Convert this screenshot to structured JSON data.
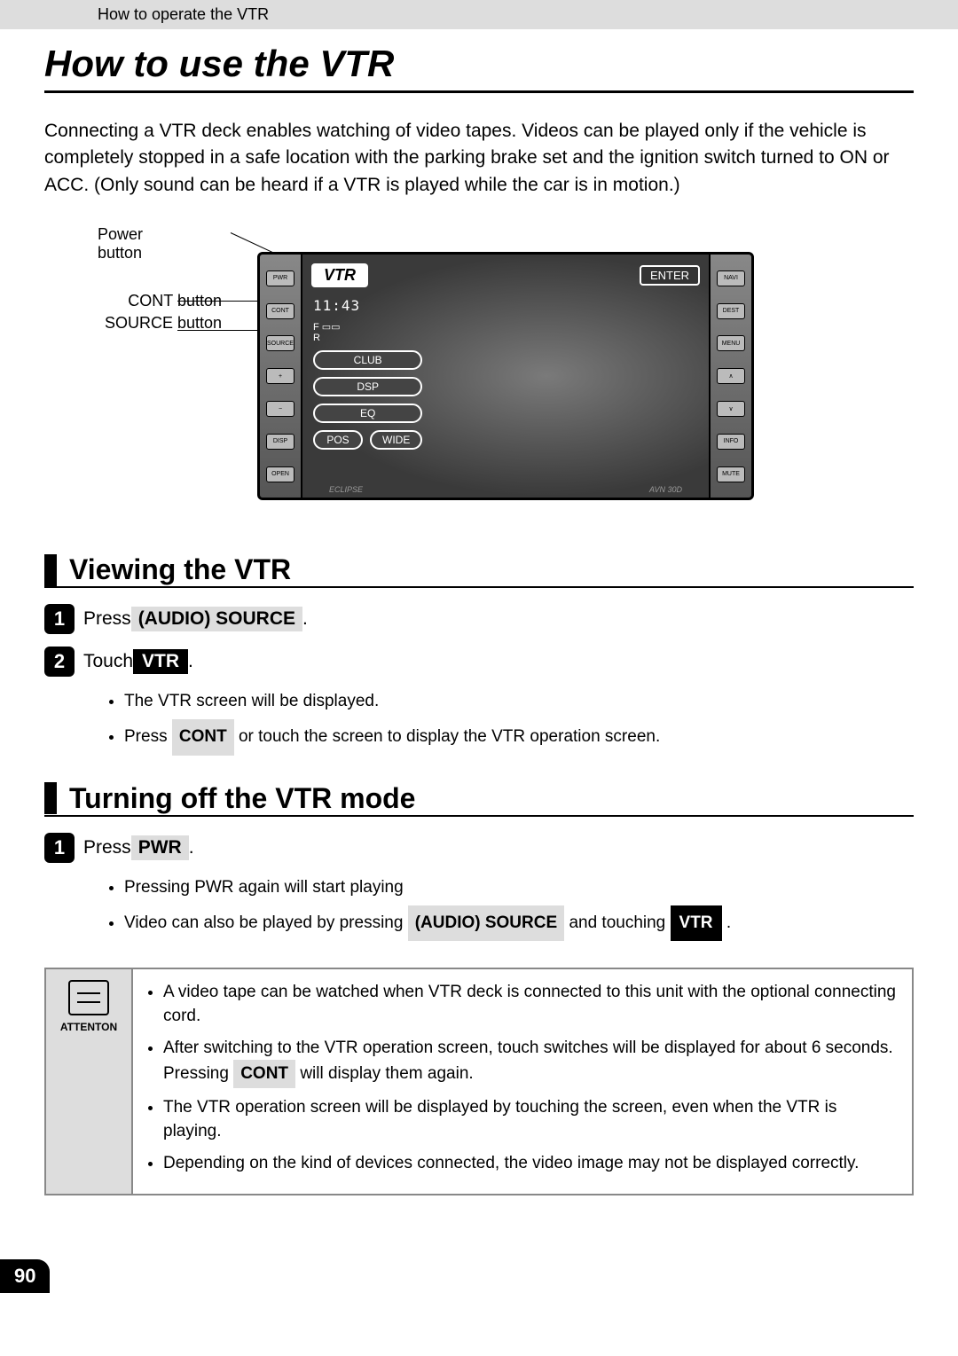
{
  "header": {
    "breadcrumb": "How to operate the VTR"
  },
  "title": "How to use the VTR",
  "intro": "Connecting a VTR deck enables watching of video tapes.  Videos can be played only if the vehicle is completely stopped in a safe location with the parking brake set and the ignition switch turned to ON or ACC.  (Only sound can be heard if a VTR is played while the car is in motion.)",
  "diagram": {
    "callouts": {
      "power": "Power button",
      "cont": "CONT button",
      "source": "SOURCE button"
    },
    "screen": {
      "title_tag": "VTR",
      "enter": "ENTER",
      "time": "11:43",
      "buttons": {
        "club": "CLUB",
        "dsp": "DSP",
        "eq": "EQ",
        "pos": "POS",
        "wide": "WIDE"
      },
      "brand_left": "ECLIPSE",
      "brand_right": "AVN 30D"
    },
    "side_labels": {
      "pwr": "PWR",
      "cont": "CONT",
      "source": "SOURCE",
      "navi": "NAVI",
      "dest": "DEST",
      "menu": "MENU",
      "info": "INFO",
      "mute": "MUTE",
      "disp": "DISP",
      "open": "OPEN"
    }
  },
  "sections": {
    "viewing": {
      "title": "Viewing the VTR",
      "steps": [
        {
          "num": "1",
          "prefix": "Press ",
          "button": "(AUDIO) SOURCE",
          "suffix": " ."
        },
        {
          "num": "2",
          "prefix": "Touch ",
          "button_solid": "VTR",
          "suffix": " ."
        }
      ],
      "bullets": [
        "The VTR screen will be displayed."
      ],
      "bullet2_prefix": "Press  ",
      "bullet2_button": "CONT",
      "bullet2_suffix": "  or touch the screen to display the VTR operation screen."
    },
    "turning_off": {
      "title": "Turning off the VTR mode",
      "step": {
        "num": "1",
        "prefix": "Press ",
        "button": "PWR",
        "suffix": " ."
      },
      "bullets": [
        "Pressing PWR again will start playing"
      ],
      "bullet2_prefix": "Video can also be played by pressing ",
      "bullet2_btn1": "(AUDIO) SOURCE",
      "bullet2_mid": "  and touching  ",
      "bullet2_btn2": "VTR",
      "bullet2_suffix": " ."
    }
  },
  "attention": {
    "label": "ATTENTON",
    "items": {
      "i1": "A video tape can be watched when VTR deck is connected to this unit with the optional connecting cord.",
      "i2a": "After switching to the VTR operation screen, touch switches will be displayed for about 6 seconds.  Pressing  ",
      "i2btn": "CONT",
      "i2b": "  will display them again.",
      "i3": "The VTR operation screen will be displayed by touching the screen, even when the VTR is playing.",
      "i4": "Depending on the kind of devices connected, the video image may not be displayed correctly."
    }
  },
  "page_number": "90"
}
